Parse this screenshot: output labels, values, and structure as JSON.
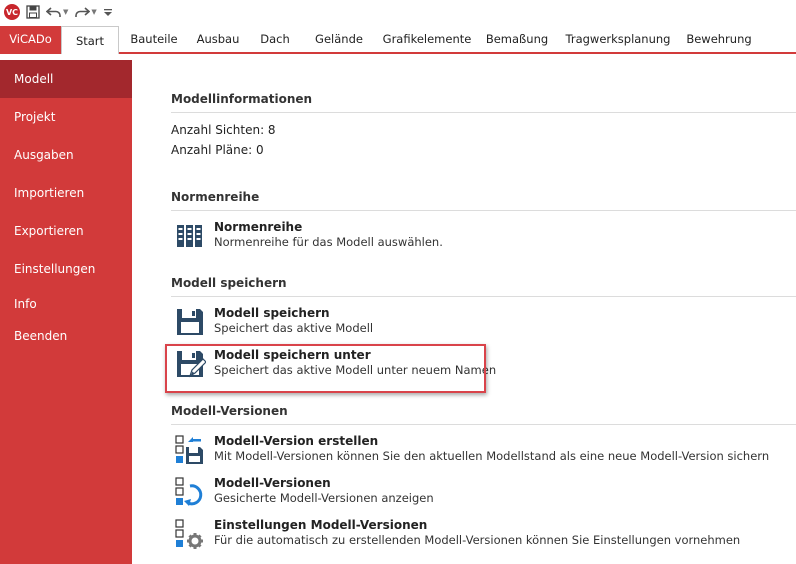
{
  "quick_access": {
    "logo_text": "VC",
    "icons": [
      "save-icon",
      "undo-icon",
      "redo-icon",
      "customize-icon"
    ]
  },
  "ribbon": {
    "app_tab": "ViCADo",
    "tabs": [
      "Start",
      "Bauteile",
      "Ausbau",
      "Dach",
      "Gelände",
      "Grafikelemente",
      "Bemaßung",
      "Tragwerksplanung",
      "Bewehrung"
    ],
    "active_tab": "Start"
  },
  "sidebar": {
    "items": [
      "Modell",
      "Projekt",
      "Ausgaben",
      "Importieren",
      "Exportieren",
      "Einstellungen",
      "Info",
      "Beenden"
    ],
    "active": "Modell"
  },
  "main": {
    "model_info": {
      "title": "Modellinformationen",
      "views": "Anzahl Sichten: 8",
      "plans": "Anzahl Pläne: 0"
    },
    "norms": {
      "title": "Normenreihe",
      "command": {
        "title": "Normenreihe",
        "desc": "Normenreihe für das Modell auswählen.",
        "icon": "norm-binders-icon"
      }
    },
    "save": {
      "title": "Modell speichern",
      "commands": [
        {
          "title": "Modell speichern",
          "desc": "Speichert das aktive Modell",
          "icon": "floppy-icon"
        },
        {
          "title": "Modell speichern unter",
          "desc": "Speichert das aktive Modell unter neuem Namen",
          "icon": "floppy-pen-icon"
        }
      ],
      "highlighted": "Modell speichern unter"
    },
    "versions": {
      "title": "Modell-Versionen",
      "commands": [
        {
          "title": "Modell-Version erstellen",
          "desc": "Mit Modell-Versionen können Sie den aktuellen Modellstand als eine neue Modell-Version sichern",
          "icon": "version-create-icon"
        },
        {
          "title": "Modell-Versionen",
          "desc": "Gesicherte Modell-Versionen anzeigen",
          "icon": "version-list-icon"
        },
        {
          "title": "Einstellungen Modell-Versionen",
          "desc": "Für die automatisch zu erstellenden Modell-Versionen können Sie Einstellungen vornehmen",
          "icon": "version-settings-icon"
        }
      ]
    }
  },
  "colors": {
    "accent": "#d23a3a",
    "sidebar_active": "#a3282d",
    "highlight_border": "#d9434a",
    "icon_blue": "#1f7fd6"
  }
}
